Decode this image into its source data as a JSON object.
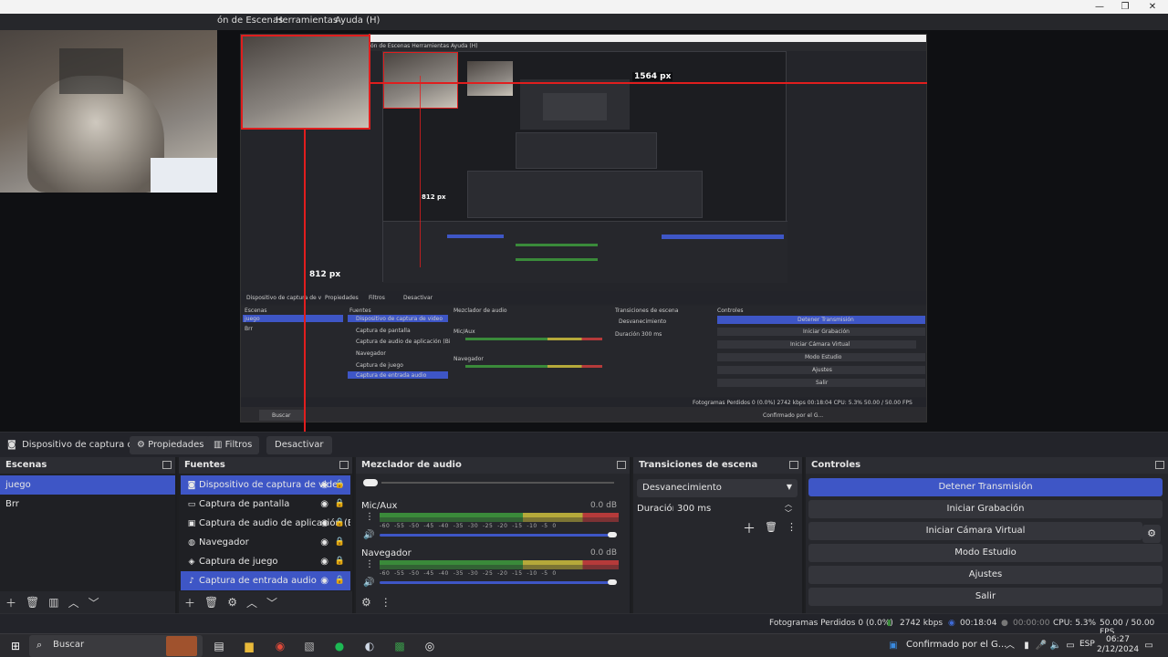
{
  "window": {
    "minimize": "—",
    "maximize": "❐",
    "close": "✕"
  },
  "menubar": {
    "items": [
      "ón de Escenas",
      "Herramientas",
      "Ayuda (H)"
    ]
  },
  "preview": {
    "px_label_width": "1564 px",
    "px_label_height": "812 px",
    "px_label_inner": "812 px"
  },
  "source_bar": {
    "source_name": "Dispositivo de captura de v",
    "properties": "Propiedades",
    "filters": "Filtros",
    "deactivate": "Desactivar"
  },
  "scenes": {
    "title": "Escenas",
    "items": [
      "juego",
      "Brr"
    ],
    "selected_index": 0
  },
  "sources": {
    "title": "Fuentes",
    "items": [
      {
        "label": "Dispositivo de captura de video",
        "icon": "camera-icon",
        "selected": true
      },
      {
        "label": "Captura de pantalla",
        "icon": "monitor-icon",
        "selected": false
      },
      {
        "label": "Captura de audio de aplicación (Bi",
        "icon": "app-audio-icon",
        "selected": false
      },
      {
        "label": "Navegador",
        "icon": "globe-icon",
        "selected": false
      },
      {
        "label": "Captura de juego",
        "icon": "gamepad-icon",
        "selected": false
      },
      {
        "label": "Captura de entrada audio",
        "icon": "microphone-icon",
        "selected": true
      }
    ]
  },
  "mixer": {
    "title": "Mezclador de audio",
    "channels": [
      {
        "name": "Mic/Aux",
        "db": "0.0 dB",
        "level": 0.45
      },
      {
        "name": "Navegador",
        "db": "0.0 dB",
        "level": 0.6
      }
    ],
    "tick_labels": [
      "-60",
      "-55",
      "-50",
      "-45",
      "-40",
      "-35",
      "-30",
      "-25",
      "-20",
      "-15",
      "-10",
      "-5",
      "0"
    ]
  },
  "transitions": {
    "title": "Transiciones de escena",
    "selected": "Desvanecimiento",
    "duration_label": "Duración",
    "duration_value": "300 ms"
  },
  "controls": {
    "title": "Controles",
    "buttons": [
      "Detener Transmisión",
      "Iniciar Grabación",
      "Iniciar Cámara Virtual",
      "Modo Estudio",
      "Ajustes",
      "Salir"
    ]
  },
  "status": {
    "dropped": "Fotogramas Perdidos 0 (0.0%)",
    "bitrate": "2742 kbps",
    "stream_time": "00:18:04",
    "rec_time": "00:00:00",
    "cpu": "CPU: 5.3%",
    "fps": "50.00 / 50.00 FPS"
  },
  "taskbar": {
    "search": "Buscar",
    "notification": "Confirmado por el G...",
    "lang": "ESP",
    "time": "06:27",
    "date": "2/12/2024"
  },
  "colors": {
    "accent": "#3e56c6",
    "panel": "#26272c",
    "dark": "#1f2024",
    "red_guides": "#e01e1e"
  }
}
